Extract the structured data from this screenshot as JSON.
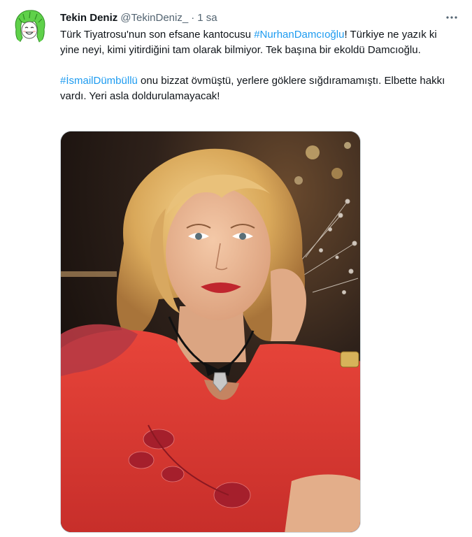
{
  "tweet": {
    "author_name": "Tekin Deniz",
    "author_handle": "@TekinDeniz_",
    "separator": "·",
    "time": "1 sa",
    "paragraph1": {
      "before": "Türk Tiyatrosu'nun son efsane kantocusu ",
      "hashtag": "#NurhanDamcıoğlu",
      "after": "! Türkiye ne yazık ki yine neyi, kimi yitirdiğini tam olarak bilmiyor. Tek başına bir ekoldü Damcıoğlu."
    },
    "paragraph2": {
      "hashtag": "#İsmailDümbüllü",
      "after": " onu bizzat övmüştü, yerlere göklere sığdıramamıştı. Elbette hakkı vardı. Yeri asla doldurulamayacak!"
    }
  },
  "icons": {
    "avatar": "green-hair-cartoon-avatar",
    "more": "more-dots-icon"
  },
  "colors": {
    "link": "#1d9bf0",
    "secondary_text": "#536471",
    "primary_text": "#0f1419"
  }
}
